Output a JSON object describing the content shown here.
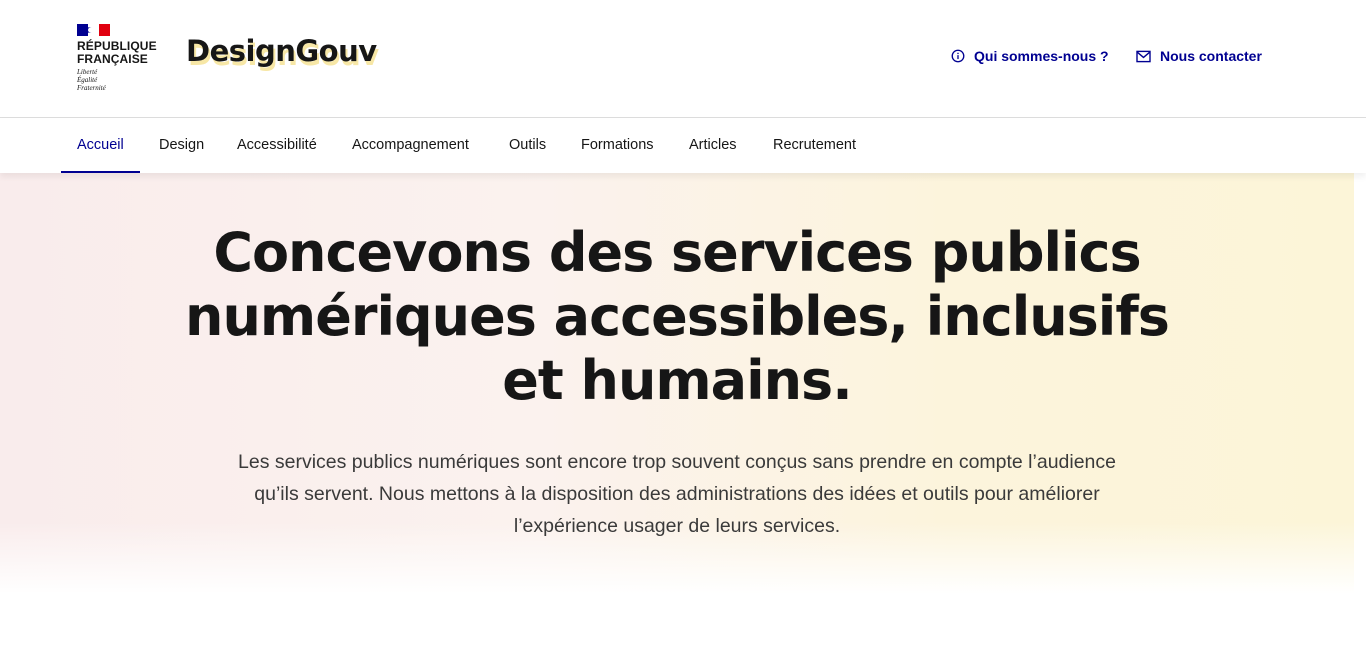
{
  "header": {
    "republic_line1": "RÉPUBLIQUE",
    "republic_line2": "FRANÇAISE",
    "motto_line1": "Liberté",
    "motto_line2": "Égalité",
    "motto_line3": "Fraternité",
    "brand": "DesignGouv",
    "tools": {
      "about_label": "Qui sommes-nous ?",
      "about_icon": "info-icon",
      "contact_label": "Nous contacter",
      "contact_icon": "mail-icon"
    }
  },
  "nav": {
    "items": [
      {
        "label": "Accueil",
        "active": true
      },
      {
        "label": "Design",
        "active": false
      },
      {
        "label": "Accessibilité",
        "active": false
      },
      {
        "label": "Accompagnement",
        "active": false
      },
      {
        "label": "Outils",
        "active": false
      },
      {
        "label": "Formations",
        "active": false
      },
      {
        "label": "Articles",
        "active": false
      },
      {
        "label": "Recrutement",
        "active": false
      }
    ]
  },
  "hero": {
    "title": "Concevons des services publics numériques accessibles, inclusifs et humains.",
    "lead": "Les services publics numériques sont encore trop souvent conçus sans prendre en compte l’audience qu’ils servent. Nous mettons à la disposition des administrations des idées et outils pour améliorer l’expérience usager de leurs services."
  },
  "colors": {
    "primary": "#000091",
    "flag_blue": "#000091",
    "flag_red": "#e1000f",
    "text": "#161616",
    "brand_shadow": "#f7e7a6"
  }
}
